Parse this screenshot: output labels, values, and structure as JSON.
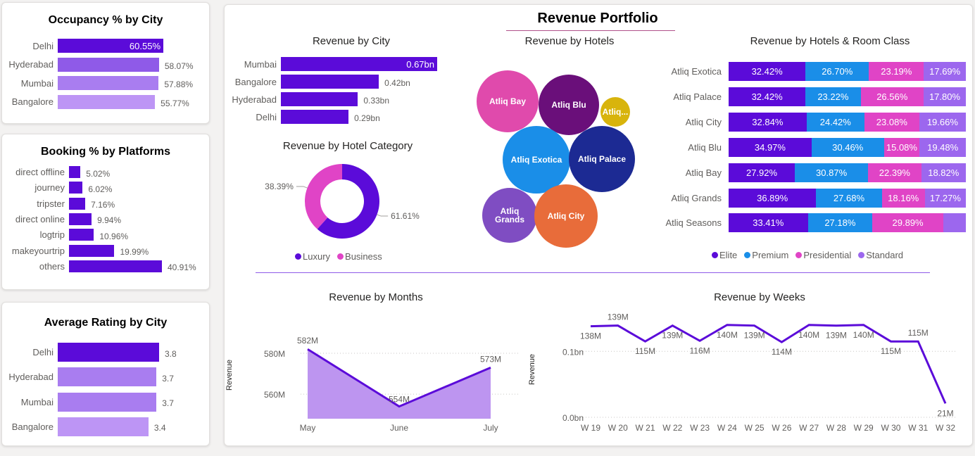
{
  "occupancy": {
    "title": "Occupancy % by City",
    "chart_data": {
      "type": "bar",
      "categories": [
        "Delhi",
        "Hyderabad",
        "Mumbai",
        "Bangalore"
      ],
      "values": [
        60.55,
        58.07,
        57.88,
        55.77
      ],
      "labels": [
        "60.55%",
        "58.07%",
        "57.88%",
        "55.77%"
      ],
      "colors": [
        "#5b0bd9",
        "#8f5ae8",
        "#a97df0",
        "#bd95f5"
      ]
    }
  },
  "booking": {
    "title": "Booking % by Platforms",
    "chart_data": {
      "type": "bar",
      "categories": [
        "direct offline",
        "journey",
        "tripster",
        "direct online",
        "logtrip",
        "makeyourtrip",
        "others"
      ],
      "values": [
        5.02,
        6.02,
        7.16,
        9.94,
        10.96,
        19.99,
        40.91
      ],
      "labels": [
        "5.02%",
        "6.02%",
        "7.16%",
        "9.94%",
        "10.96%",
        "19.99%",
        "40.91%"
      ],
      "color": "#5b0bd9"
    }
  },
  "rating": {
    "title": "Average Rating by City",
    "chart_data": {
      "type": "bar",
      "categories": [
        "Delhi",
        "Hyderabad",
        "Mumbai",
        "Bangalore"
      ],
      "values": [
        3.8,
        3.7,
        3.7,
        3.4
      ],
      "labels": [
        "3.8",
        "3.7",
        "3.7",
        "3.4"
      ],
      "colors": [
        "#5b0bd9",
        "#a97df0",
        "#a97df0",
        "#bd95f5"
      ]
    }
  },
  "portfolio": {
    "title": "Revenue Portfolio",
    "city": {
      "title": "Revenue by City",
      "chart_data": {
        "type": "bar",
        "categories": [
          "Mumbai",
          "Bangalore",
          "Hyderabad",
          "Delhi"
        ],
        "values": [
          0.67,
          0.42,
          0.33,
          0.29
        ],
        "labels": [
          "0.67bn",
          "0.42bn",
          "0.33bn",
          "0.29bn"
        ],
        "color": "#5b0bd9"
      }
    },
    "category": {
      "title": "Revenue by Hotel Category",
      "chart_data": {
        "type": "pie",
        "categories": [
          "Luxury",
          "Business"
        ],
        "values": [
          61.61,
          38.39
        ],
        "labels": [
          "61.61%",
          "38.39%"
        ],
        "colors": [
          "#5b0bd9",
          "#e044c6"
        ]
      },
      "legend": [
        {
          "name": "Luxury",
          "color": "#5b0bd9"
        },
        {
          "name": "Business",
          "color": "#e044c6"
        }
      ]
    },
    "hotels": {
      "title": "Revenue by Hotels",
      "bubbles": [
        {
          "name": "Atliq Bay",
          "color": "#e04aac"
        },
        {
          "name": "Atliq Blu",
          "color": "#6a0f7a"
        },
        {
          "name": "Atliq...",
          "color": "#d8b40c"
        },
        {
          "name": "Atliq Exotica",
          "color": "#1a8ee8"
        },
        {
          "name": "Atliq Palace",
          "color": "#1c2a93"
        },
        {
          "name": "Atliq Grands",
          "color": "#7f4dc2"
        },
        {
          "name": "Atliq City",
          "color": "#e86c3a"
        }
      ]
    },
    "room_class": {
      "title": "Revenue by Hotels & Room Class",
      "chart_data": {
        "type": "bar",
        "stacked": true,
        "categories": [
          "Atliq Exotica",
          "Atliq Palace",
          "Atliq City",
          "Atliq Blu",
          "Atliq Bay",
          "Atliq Grands",
          "Atliq Seasons"
        ],
        "series": [
          {
            "name": "Elite",
            "color": "#5b0bd9",
            "values": [
              32.42,
              32.42,
              32.84,
              34.97,
              27.92,
              36.89,
              33.41
            ],
            "labels": [
              "32.42%",
              "32.42%",
              "32.84%",
              "34.97%",
              "27.92%",
              "36.89%",
              "33.41%"
            ]
          },
          {
            "name": "Premium",
            "color": "#1a8ee8",
            "values": [
              26.7,
              23.22,
              24.42,
              30.46,
              30.87,
              27.68,
              27.18
            ],
            "labels": [
              "26.70%",
              "23.22%",
              "24.42%",
              "30.46%",
              "30.87%",
              "27.68%",
              "27.18%"
            ]
          },
          {
            "name": "Presidential",
            "color": "#e044c6",
            "values": [
              23.19,
              26.56,
              23.08,
              15.08,
              22.39,
              18.16,
              29.89
            ],
            "labels": [
              "23.19%",
              "26.56%",
              "23.08%",
              "15.08%",
              "22.39%",
              "18.16%",
              "29.89%"
            ]
          },
          {
            "name": "Standard",
            "color": "#9c67ee",
            "values": [
              17.69,
              17.8,
              19.66,
              19.48,
              18.82,
              17.27,
              9.52
            ],
            "labels": [
              "17.69%",
              "17.80%",
              "19.66%",
              "19.48%",
              "18.82%",
              "17.27%",
              ""
            ]
          }
        ]
      }
    }
  },
  "months": {
    "title": "Revenue by Months",
    "chart_data": {
      "type": "area",
      "categories": [
        "May",
        "June",
        "July"
      ],
      "values": [
        582,
        554,
        573
      ],
      "labels": [
        "582M",
        "554M",
        "573M"
      ],
      "ylabel": "Revenue",
      "yticks": [
        {
          "value": 580,
          "label": "580M"
        },
        {
          "value": 560,
          "label": "560M"
        }
      ],
      "ylim": [
        548,
        590
      ],
      "color": "#5b0bd9",
      "fill": "#bd95f0"
    }
  },
  "weeks": {
    "title": "Revenue by Weeks",
    "chart_data": {
      "type": "line",
      "categories": [
        "W 19",
        "W 20",
        "W 21",
        "W 22",
        "W 23",
        "W 24",
        "W 25",
        "W 26",
        "W 27",
        "W 28",
        "W 29",
        "W 30",
        "W 31",
        "W 32"
      ],
      "values": [
        138,
        139,
        115,
        139,
        116,
        140,
        139,
        114,
        140,
        139,
        140,
        115,
        115,
        21
      ],
      "labels": [
        "138M",
        "139M",
        "115M",
        "139M",
        "116M",
        "140M",
        "139M",
        "114M",
        "140M",
        "139M",
        "140M",
        "115M",
        "115M",
        "21M"
      ],
      "label_pos": [
        "below",
        "above",
        "below",
        "below",
        "below",
        "below",
        "below",
        "below",
        "below",
        "below",
        "below",
        "below",
        "above",
        "below"
      ],
      "ylabel": "Revenue",
      "yticks": [
        {
          "value": 100,
          "label": "0.1bn"
        },
        {
          "value": 0,
          "label": "0.0bn"
        }
      ],
      "ylim": [
        0,
        160
      ],
      "color": "#5b0bd9"
    }
  }
}
